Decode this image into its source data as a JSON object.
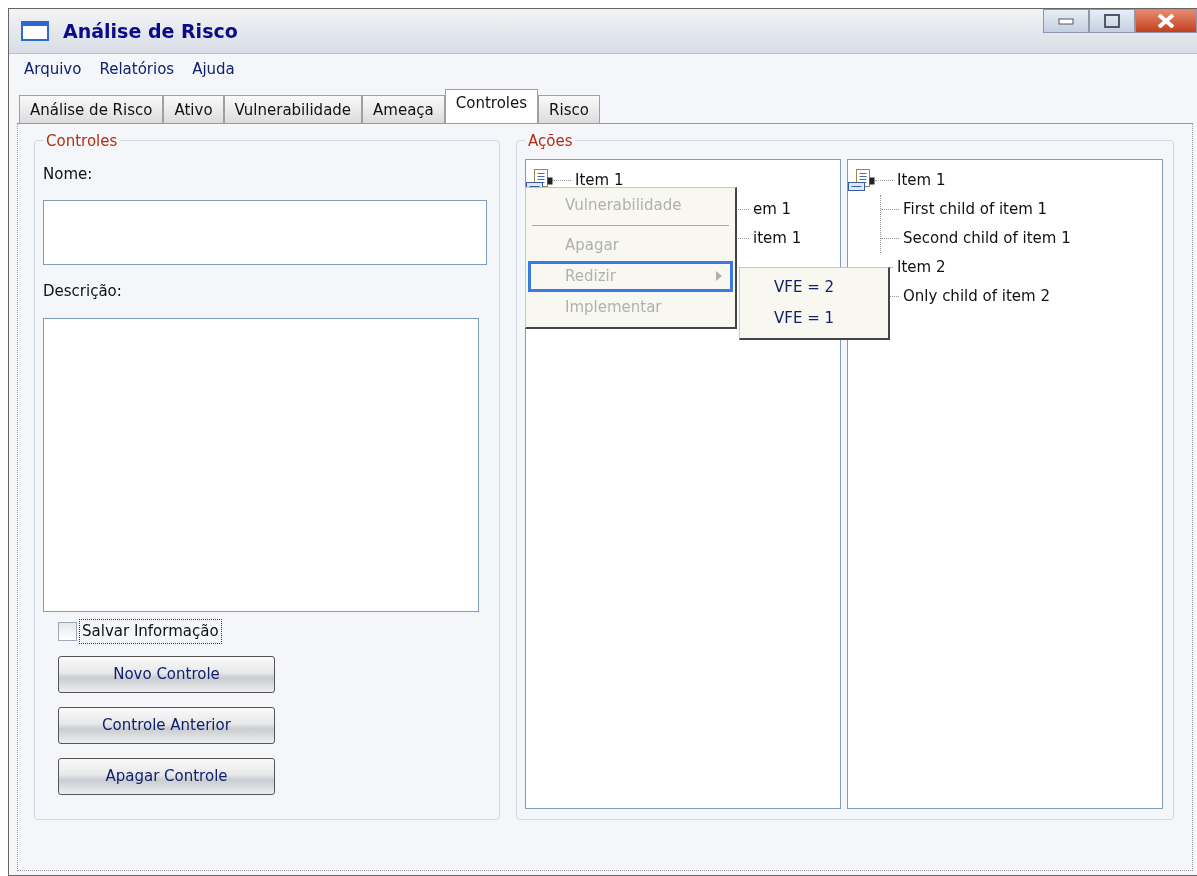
{
  "window": {
    "title": "Análise de Risco"
  },
  "menu_bar": [
    "Arquivo",
    "Relatórios",
    "Ajuda"
  ],
  "tabs": [
    {
      "label": "Análise de Risco",
      "selected": false
    },
    {
      "label": "Ativo",
      "selected": false
    },
    {
      "label": "Vulnerabilidade",
      "selected": false
    },
    {
      "label": "Ameaça",
      "selected": false
    },
    {
      "label": "Controles",
      "selected": true
    },
    {
      "label": "Risco",
      "selected": false
    }
  ],
  "controles": {
    "title": "Controles",
    "name_label": "Nome:",
    "description_label": "Descrição:",
    "save_checkbox": {
      "label": "Salvar Informação",
      "checked": false
    },
    "buttons": [
      "Novo Controle",
      "Controle Anterior",
      "Apagar Controle"
    ]
  },
  "acoes": {
    "title": "Ações",
    "left_tree": [
      {
        "label": "Item 1",
        "icon": true,
        "children": [
          {
            "label": "em 1"
          },
          {
            "label": "item 1"
          }
        ]
      }
    ],
    "right_tree": [
      {
        "label": "Item 1",
        "icon": true,
        "children": [
          {
            "label": "First child of item 1"
          },
          {
            "label": "Second child of item 1"
          }
        ]
      },
      {
        "label": "Item 2",
        "icon": false,
        "children": [
          {
            "label": "Only child of item 2"
          }
        ]
      }
    ],
    "context_menu": [
      {
        "kind": "item",
        "label": "Vulnerabilidade",
        "disabled": true,
        "selected": false
      },
      {
        "kind": "separator"
      },
      {
        "kind": "item",
        "label": "Apagar",
        "disabled": true,
        "selected": false
      },
      {
        "kind": "submenu",
        "label": "Redizir",
        "disabled": true,
        "selected": true
      },
      {
        "kind": "item",
        "label": "Implementar",
        "disabled": true,
        "selected": false
      }
    ],
    "submenu": [
      "VFE = 2",
      "VFE = 1"
    ]
  }
}
